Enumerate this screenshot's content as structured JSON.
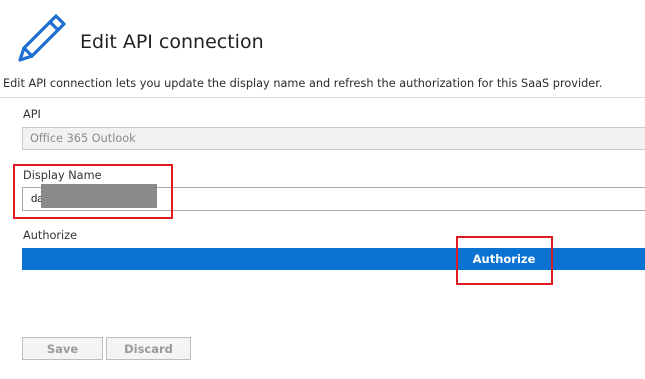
{
  "header": {
    "title": "Edit API connection",
    "icon": "pencil-icon"
  },
  "description": "Edit API connection lets you update the display name and refresh the authorization for this SaaS provider.",
  "form": {
    "api_label": "API",
    "api_value": "Office 365 Outlook",
    "display_name_label": "Display Name",
    "display_name_value": "da",
    "authorize_label": "Authorize",
    "authorize_button": "Authorize"
  },
  "footer": {
    "save_label": "Save",
    "discard_label": "Discard"
  },
  "colors": {
    "accent": "#0a72d1",
    "annotation": "#e01a22"
  }
}
